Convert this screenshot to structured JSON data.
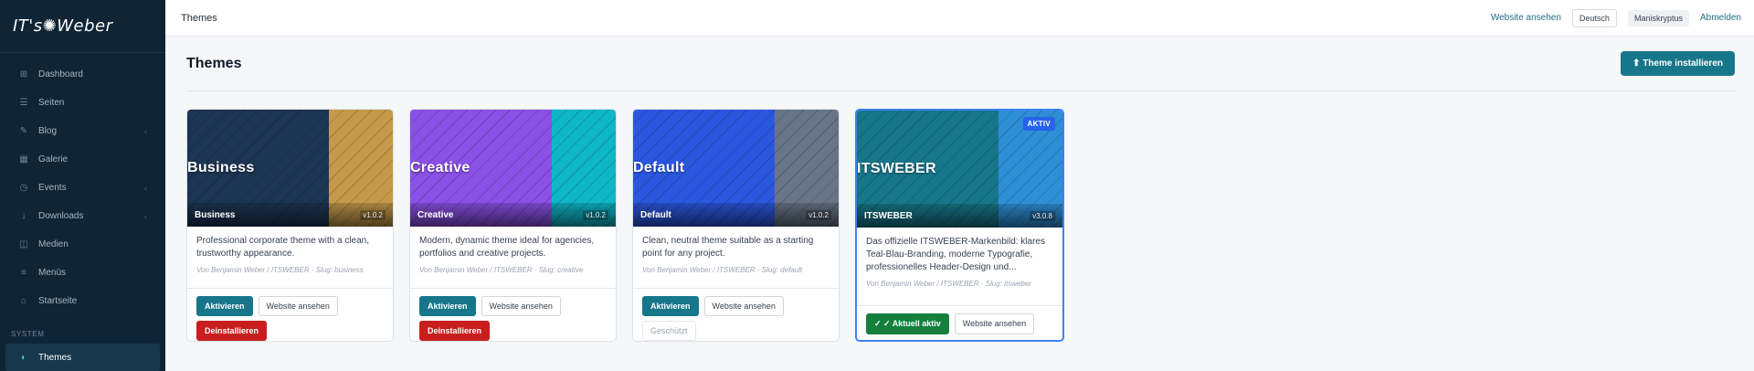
{
  "sidebar": {
    "logo": "IT's✺Weber",
    "items": [
      {
        "label": "Dashboard",
        "icon": "⊞",
        "chevron": false
      },
      {
        "label": "Seiten",
        "icon": "☰",
        "chevron": false
      },
      {
        "label": "Blog",
        "icon": "✎",
        "chevron": true
      },
      {
        "label": "Galerie",
        "icon": "▦",
        "chevron": false
      },
      {
        "label": "Events",
        "icon": "◷",
        "chevron": true
      },
      {
        "label": "Downloads",
        "icon": "↓",
        "chevron": true
      },
      {
        "label": "Medien",
        "icon": "◫",
        "chevron": false
      },
      {
        "label": "Menüs",
        "icon": "≡",
        "chevron": false
      },
      {
        "label": "Startseite",
        "icon": "⌂",
        "chevron": false
      }
    ],
    "section": "SYSTEM",
    "active_item": {
      "label": "Themes",
      "icon": "◐"
    }
  },
  "topbar": {
    "title": "Themes",
    "view_site": "Website ansehen",
    "language": "Deutsch",
    "user": "Maniskryptus",
    "logout": "Abmelden"
  },
  "page": {
    "title": "Themes",
    "install_button": "⬆ Theme installieren"
  },
  "themes": [
    {
      "thumb_name": "Business",
      "name": "Business",
      "version": "v1.0.2",
      "colors": {
        "left": "#1d3553",
        "right": "#c49a4a"
      },
      "description": "Professional corporate theme with a clean, trustworthy appearance.",
      "meta": "Von Benjamin Weber / ITSWEBER · Slug: business",
      "buttons": {
        "activate": "Aktivieren",
        "view": "Website ansehen",
        "uninstall": "Deinstallieren"
      }
    },
    {
      "thumb_name": "Creative",
      "name": "Creative",
      "version": "v1.0.2",
      "colors": {
        "left": "#8b50e6",
        "right": "#0fb6c8"
      },
      "description": "Modern, dynamic theme ideal for agencies, portfolios and creative projects.",
      "meta": "Von Benjamin Weber / ITSWEBER · Slug: creative",
      "buttons": {
        "activate": "Aktivieren",
        "view": "Website ansehen",
        "uninstall": "Deinstallieren"
      }
    },
    {
      "thumb_name": "Default",
      "name": "Default",
      "version": "v1.0.2",
      "colors": {
        "left": "#2b57e0",
        "right": "#687586"
      },
      "description": "Clean, neutral theme suitable as a starting point for any project.",
      "meta": "Von Benjamin Weber / ITSWEBER · Slug: default",
      "buttons": {
        "activate": "Aktivieren",
        "view": "Website ansehen",
        "protected": "Geschützt"
      }
    },
    {
      "thumb_name": "ITSWEBER",
      "name": "ITSWEBER",
      "version": "v3.0.8",
      "badge": "AKTIV",
      "colors": {
        "left": "#17768a",
        "right": "#2f8fd6"
      },
      "description": "Das offizielle ITSWEBER-Markenbild: klares Teal-Blau-Branding, moderne Typografie, professionelles Header-Design und...",
      "meta": "Von Benjamin Weber / ITSWEBER · Slug: itsweber",
      "buttons": {
        "current": "✓ ✓ Aktuell aktiv",
        "view": "Website ansehen"
      }
    }
  ]
}
